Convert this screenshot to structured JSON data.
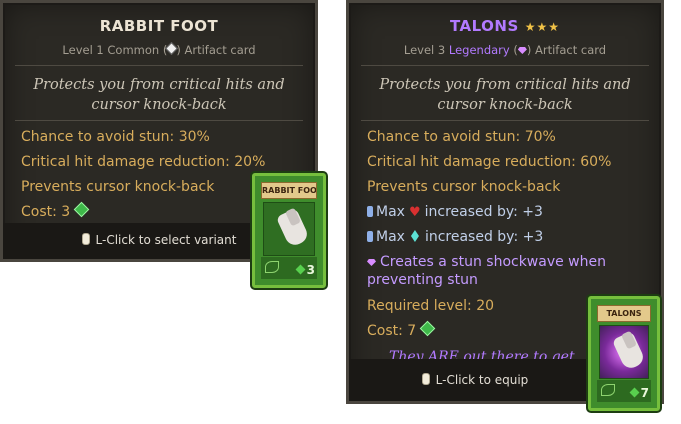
{
  "left_tooltip": {
    "title": "RABBIT FOOT",
    "subtitle_pre": "Level 1 Common (",
    "subtitle_post": ") Artifact card",
    "flavor": "Protects you from critical hits and cursor knock-back",
    "stats": [
      "Chance to avoid stun: 30%",
      "Critical hit damage reduction: 20%",
      "Prevents cursor knock-back"
    ],
    "cost_label": "Cost: 3",
    "hint": "L-Click to select variant"
  },
  "right_tooltip": {
    "title": "TALONS",
    "stars": "★★★",
    "subtitle_pre": "Level 3 ",
    "rarity": "Legendary",
    "subtitle_mid": " (",
    "subtitle_post": ") Artifact card",
    "flavor": "Protects you from critical hits and cursor knock-back",
    "stats": [
      "Chance to avoid stun: 70%",
      "Critical hit damage reduction: 60%",
      "Prevents cursor knock-back"
    ],
    "max_health": {
      "pre": "Max",
      "post": "increased by: +3"
    },
    "max_mana": {
      "pre": "Max",
      "post": "increased by: +3"
    },
    "special": "Creates a stun shockwave when preventing stun",
    "required_level": "Required level: 20",
    "cost_label": "Cost: 7",
    "quote": "They ARE out there to get",
    "hint": "L-Click to equip"
  },
  "cards": {
    "left": {
      "name": "RABBIT FOOT",
      "cost": "3"
    },
    "right": {
      "name": "TALONS",
      "cost": "7"
    }
  },
  "colors": {
    "background": "#2b2924",
    "stat_gold": "#d8ad5c",
    "legendary_purple": "#b27aff",
    "card_green": "#3f8d2c"
  },
  "icons": [
    "mouse-left-icon",
    "cost-gem-icon",
    "common-diamond-icon",
    "legendary-gem-icon",
    "vial-icon",
    "heart-icon",
    "mana-crystal-icon",
    "star-icon"
  ]
}
